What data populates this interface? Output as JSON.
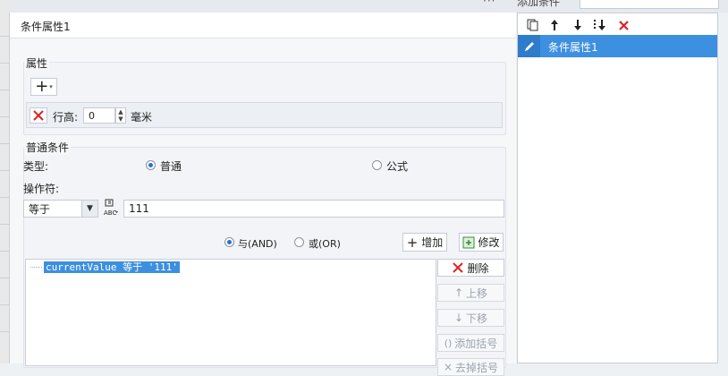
{
  "dialog": {
    "title": "条件属性1",
    "attributes": {
      "legend": "属性",
      "add_glyph": "+",
      "row_height_label": "行高:",
      "row_height_value": "0",
      "unit": "毫米"
    },
    "normal_condition": {
      "legend": "普通条件",
      "type_label": "类型:",
      "type_options": [
        "普通",
        "公式"
      ],
      "type_selected": "普通",
      "operator_label": "操作符:",
      "operator_value": "等于",
      "value_input": "111",
      "logic_options": [
        "与(AND)",
        "或(OR)"
      ],
      "logic_selected": "与(AND)",
      "add_button": "增加",
      "edit_button": "修改",
      "conditions": [
        "currentValue 等于 '111'"
      ],
      "delete_button": "删除",
      "move_up_button": "上移",
      "move_down_button": "下移",
      "add_bracket_button": "添加括号",
      "remove_bracket_button": "去掉括号"
    }
  },
  "right_panel": {
    "top_tab_partial": "添加条件",
    "toolbar_icons": [
      "copy-icon",
      "arrow-up-icon",
      "arrow-down-icon",
      "sort-down-icon",
      "delete-icon"
    ],
    "items": [
      {
        "label": "条件属性1",
        "selected": true
      }
    ]
  },
  "colors": {
    "selection": "#3d8fe0",
    "delete_red": "#e02020",
    "radio_dot": "#2a6fd6"
  }
}
